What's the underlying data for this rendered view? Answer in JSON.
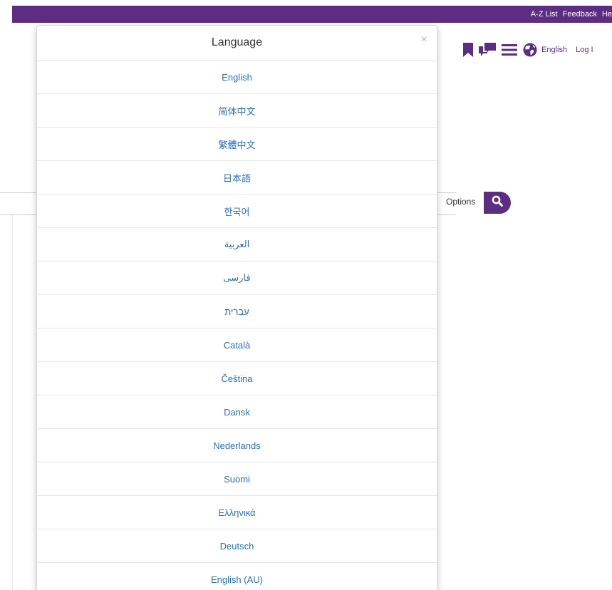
{
  "topbar": {
    "links": [
      "A-Z List",
      "Feedback",
      "He"
    ]
  },
  "header": {
    "language_label": "English",
    "login_label": "Log I",
    "icons": [
      "bookmark-icon",
      "chat-icon",
      "menu-icon",
      "globe-icon"
    ]
  },
  "search": {
    "options_label": "Options",
    "button_icon": "search-icon"
  },
  "colors": {
    "brand_purple": "#5c2d82",
    "link_blue": "#2a6fb7"
  },
  "modal": {
    "title": "Language",
    "close_label": "×",
    "languages": [
      "English",
      "简体中文",
      "繁體中文",
      "日本語",
      "한국어",
      "العربية",
      "فارسی",
      "עברית",
      "Català",
      "Čeština",
      "Dansk",
      "Nederlands",
      "Suomi",
      "Ελληνικά",
      "Deutsch",
      "English (AU)"
    ]
  }
}
